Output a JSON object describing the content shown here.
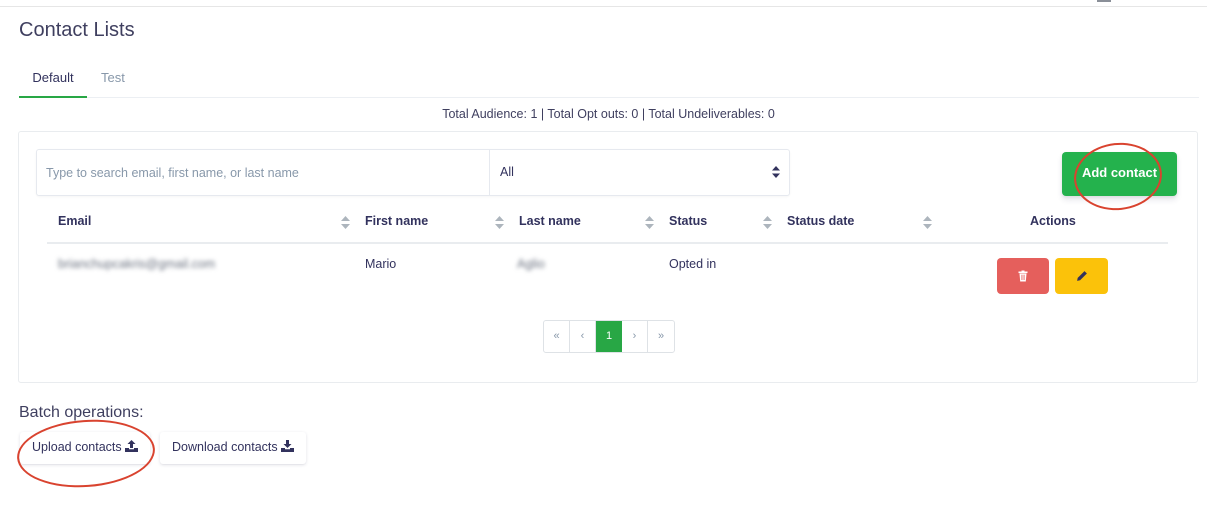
{
  "page": {
    "title": "Contact Lists"
  },
  "tabs": [
    {
      "label": "Default",
      "active": true
    },
    {
      "label": "Test",
      "active": false
    }
  ],
  "totals": "Total Audience: 1 | Total Opt outs: 0 | Total Undeliverables: 0",
  "search": {
    "placeholder": "Type to search email, first name, or last name",
    "value": ""
  },
  "filter": {
    "selected": "All"
  },
  "add_contact_label": "Add contact",
  "table": {
    "columns": [
      "Email",
      "First name",
      "Last name",
      "Status",
      "Status date",
      "Actions"
    ],
    "rows": [
      {
        "email": "brianchupcakris@gmail.com",
        "first_name": "Mario",
        "last_name": "Aglio",
        "status": "Opted in",
        "status_date": ""
      }
    ]
  },
  "pagination": {
    "first": "«",
    "prev": "‹",
    "current": "1",
    "next": "›",
    "last": "»"
  },
  "batch": {
    "title": "Batch operations:",
    "upload_label": "Upload contacts",
    "download_label": "Download contacts"
  },
  "colors": {
    "accent_green": "#28a745",
    "add_button": "#24b24d",
    "delete_button": "#e55f5c",
    "edit_button": "#fbc20a",
    "annotation_circle": "#d9432f"
  },
  "icons": [
    "trash-icon",
    "pencil-icon",
    "upload-icon",
    "download-icon",
    "sort-icon",
    "select-arrows-icon"
  ]
}
